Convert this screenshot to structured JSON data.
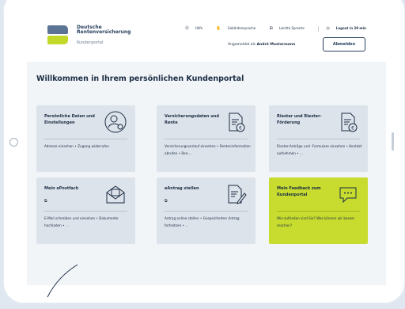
{
  "brand": {
    "line1": "Deutsche",
    "line2": "Rentenversicherung",
    "portal": "Kundenportal"
  },
  "toplinks": {
    "help": "Hilfe",
    "sign_language": "Gebärdensprache",
    "plain_language": "Leichte Sprache",
    "logout_timer": "Logout in 29 min"
  },
  "user": {
    "prefix": "Angemeldet als",
    "name": "André Mustermann",
    "logout_button": "Abmelden"
  },
  "welcome": "Willkommen in Ihrem persönlichen Kundenportal",
  "tiles": [
    {
      "title": "Persönliche Daten und Einstellungen",
      "desc": "Adresse einsehen • Zugang widerrufen",
      "icon": "user-settings-icon"
    },
    {
      "title": "Versicherungsdaten und Rente",
      "desc": "Versicherungsverlauf einsehen • Renteninformation abrufen • Ren-...",
      "icon": "euro-document-icon"
    },
    {
      "title": "Riester und Riester-Förderung",
      "desc": "Riester-Anträge und -Formulare einsehen • Kontakt aufnehmen • ...",
      "icon": "euro-document-icon"
    },
    {
      "title": "Mein ePostfach",
      "desc": "E-Mail schreiben und einsehen • Dokumente hochladen • ...",
      "icon": "mailbox-icon",
      "external": "⧉"
    },
    {
      "title": "eAntrag stellen",
      "desc": "Antrag online stellen • Gespeicherten Antrag fortsetzen • ...",
      "icon": "edit-document-icon",
      "external": "⧉"
    },
    {
      "title": "Mein Feedback zum Kundenportal",
      "desc": "Wie zufrieden sind Sie? Was können wir besser machen?",
      "icon": "chat-bubble-icon"
    }
  ],
  "colors": {
    "accent_lime": "#c7dc2f",
    "navy": "#1c2d44",
    "logo_blue": "#5b7493"
  }
}
